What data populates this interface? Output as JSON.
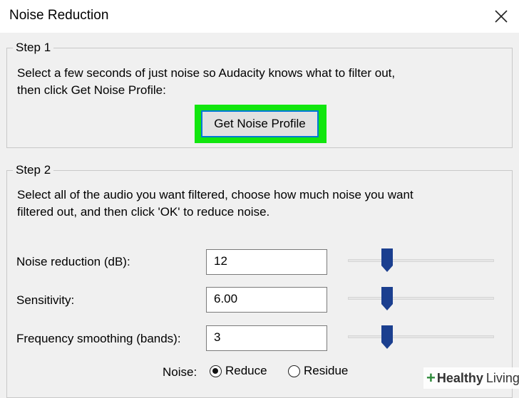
{
  "window": {
    "title": "Noise Reduction",
    "close_icon": "close-icon"
  },
  "step1": {
    "legend": "Step 1",
    "line1": "Select a few seconds of just noise so Audacity knows what to filter out,",
    "line2": "then click Get Noise Profile:",
    "button_label": "Get Noise Profile",
    "highlight_color": "#11e60e"
  },
  "step2": {
    "legend": "Step 2",
    "line1": "Select all of the audio you want filtered, choose how much noise you want",
    "line2": "filtered out, and then click 'OK' to reduce noise.",
    "fields": [
      {
        "label": "Noise reduction (dB):",
        "value": "12"
      },
      {
        "label": "Sensitivity:",
        "value": "6.00"
      },
      {
        "label": "Frequency smoothing (bands):",
        "value": "3"
      }
    ],
    "noise_label": "Noise:",
    "radio_reduce": "Reduce",
    "radio_residue": "Residue",
    "selected": "Reduce",
    "slider_color": "#1b3f8f"
  },
  "watermark": {
    "plus": "+",
    "healthy": "Healthy",
    "living": "Living"
  }
}
